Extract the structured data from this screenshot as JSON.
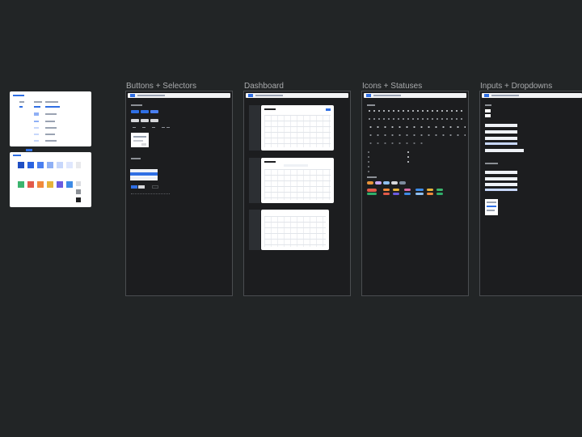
{
  "canvas": {
    "frames": [
      {
        "id": "buttons-selectors",
        "title": "Buttons + Selectors"
      },
      {
        "id": "dashboard",
        "title": "Dashboard"
      },
      {
        "id": "icons-statuses",
        "title": "Icons + Statuses"
      },
      {
        "id": "inputs-dropdowns",
        "title": "Inputs + Dropdowns"
      }
    ]
  },
  "colors": {
    "canvas_bg": "#222526",
    "frame_bg": "#1c1d1f",
    "frame_border": "#4a4d50",
    "title_text": "#a9abad",
    "accent_blue": "#2f6fe4"
  },
  "swatches": [
    "#1f4fc4",
    "#2a63e0",
    "#4a7ff0",
    "#8fb0f5",
    "#c7d7fb",
    "#dfe7fd",
    "#3cb46e",
    "#e25a4a",
    "#f08a3c",
    "#e6b33a",
    "#6b5be0",
    "#3d8be6"
  ],
  "status_pills": [
    "#e25a4a",
    "#c7a6f2",
    "#8fbff0",
    "#d6d7da",
    "#7c8c9e",
    "#e8943a",
    "#e25a4a",
    "#d86ca8",
    "#3d8be6",
    "#e6b33a",
    "#2fae6a",
    "#3cb46e",
    "#e25a4a",
    "#f08a3c",
    "#e6b33a",
    "#6b5be0",
    "#3d8be6"
  ]
}
